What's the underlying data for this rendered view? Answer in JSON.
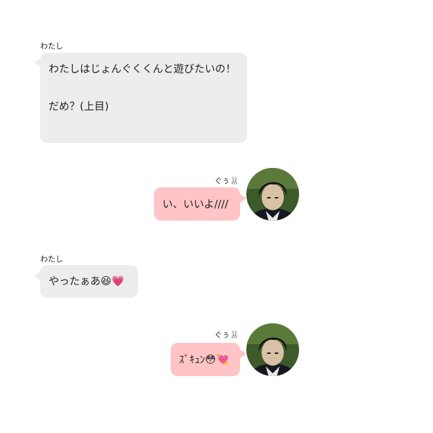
{
  "messages": [
    {
      "sender": "わたし",
      "text": "わたしはじょんぐくくんと遊びたいの！\n\nだめ？(上目)"
    },
    {
      "sender": "ぐぅ🐰",
      "text": "い、いいよ////"
    },
    {
      "sender": "わたし",
      "text": "やったぁあ😆💗"
    },
    {
      "sender": "ぐぅ🐰",
      "text": "ｽﾞｷｭﾝ😳💘"
    }
  ],
  "colors": {
    "left_bubble": "#ededed",
    "right_bubble": "#ffc4c6"
  },
  "icons": {
    "avatar": "avatar-photo"
  }
}
